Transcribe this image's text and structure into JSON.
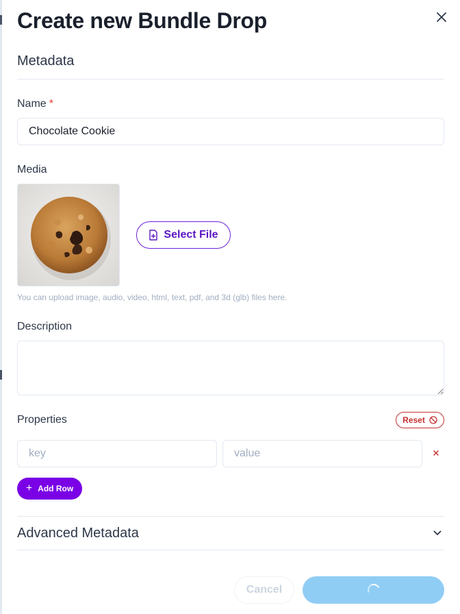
{
  "modal": {
    "title": "Create new Bundle Drop",
    "close_icon": "close-icon"
  },
  "metadata": {
    "section_title": "Metadata",
    "name": {
      "label": "Name",
      "required_mark": "*",
      "value": "Chocolate Cookie"
    },
    "media": {
      "label": "Media",
      "thumbnail": "chocolate-chip-cookie-image",
      "select_file_label": "Select File",
      "select_file_icon": "file-plus-icon",
      "hint": "You can upload image, audio, video, html, text, pdf, and 3d (glb) files here."
    },
    "description": {
      "label": "Description",
      "value": ""
    },
    "properties": {
      "label": "Properties",
      "reset_label": "Reset",
      "reset_icon": "ban-icon",
      "rows": [
        {
          "key_placeholder": "key",
          "value_placeholder": "value",
          "key": "",
          "value": "",
          "remove_icon": "remove-x-icon"
        }
      ],
      "add_row_label": "Add Row"
    },
    "advanced": {
      "label": "Advanced Metadata",
      "icon": "chevron-down-icon"
    }
  },
  "footer": {
    "cancel_label": "Cancel",
    "submit_state": "loading"
  },
  "colors": {
    "primary": "#7a00e6",
    "danger": "#c53030",
    "submit_loading": "#90cdf4",
    "border": "#e2e8f0"
  }
}
